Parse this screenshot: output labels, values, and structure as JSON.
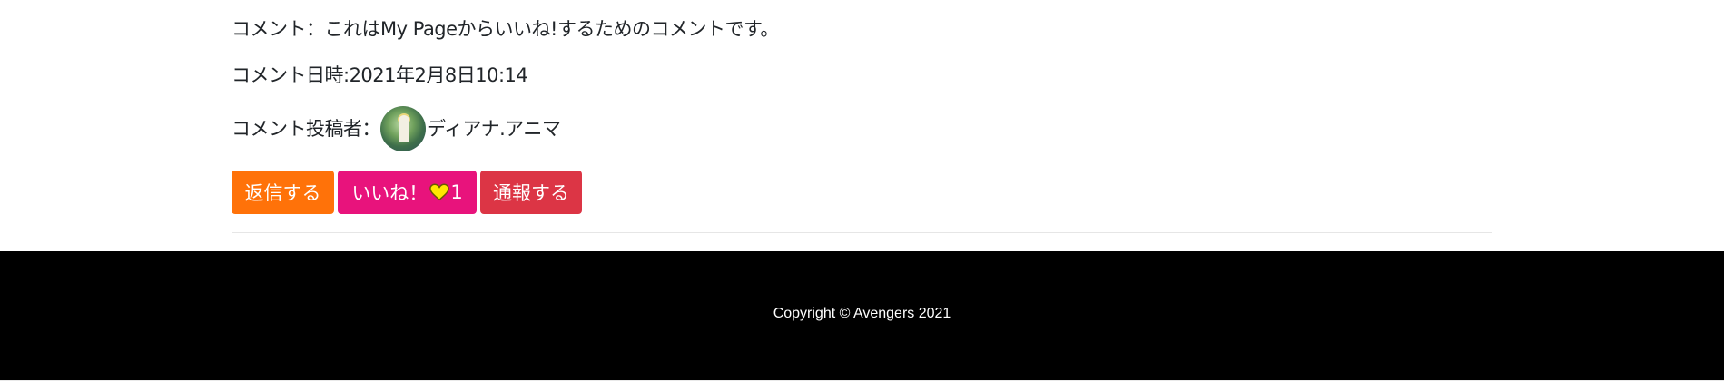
{
  "comment": {
    "text": "コメント：これはMy Pageからいいね!するためのコメントです。",
    "date": "コメント日時:2021年2月8日10:14",
    "author_label": "コメント投稿者：",
    "author_name": "ディアナ.アニマ"
  },
  "actions": {
    "reply_label": "返信する",
    "like_label": "いいね！",
    "like_count": "1",
    "report_label": "通報する"
  },
  "colors": {
    "reply": "#ff7209",
    "like": "#e8137c",
    "report": "#dc3545",
    "heart": "#ffe600"
  },
  "footer": {
    "copyright": "Copyright © Avengers 2021"
  }
}
